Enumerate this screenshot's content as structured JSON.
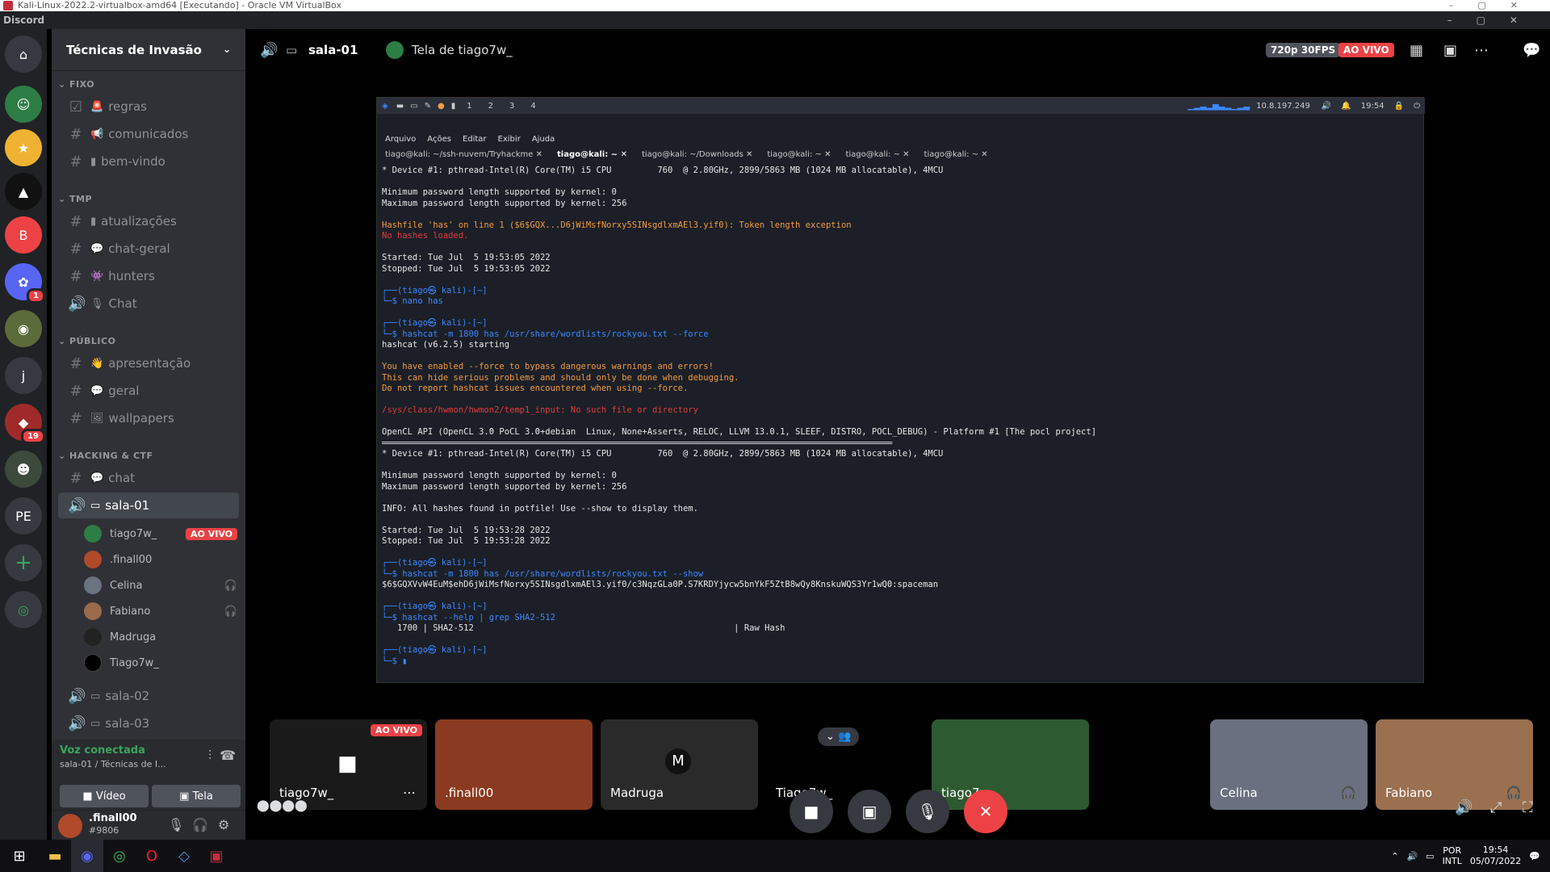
{
  "window": {
    "vbox_title": "Kali-Linux-2022.2-virtualbox-amd64 [Executando] - Oracle VM VirtualBox",
    "app_title": "Discord"
  },
  "server": {
    "name": "Técnicas de Invasão"
  },
  "categories": {
    "fixo": "FIXO",
    "tmp": "TMP",
    "publico": "PÚBLICO",
    "hacking": "HACKING & CTF"
  },
  "channels": {
    "regras": "regras",
    "comunicados": "comunicados",
    "bem_vindo": "bem-vindo",
    "atualizacoes": "atualizações",
    "chat_geral": "chat-geral",
    "hunters": "hunters",
    "chat_voice": "Chat",
    "apresentacao": "apresentação",
    "geral": "geral",
    "wallpapers": "wallpapers",
    "chat": "chat",
    "sala01": "sala-01",
    "sala02": "sala-02",
    "sala03": "sala-03"
  },
  "voice_users": [
    {
      "name": "tiago7w_",
      "live": "AO VIVO"
    },
    {
      "name": ".finall00"
    },
    {
      "name": "Celina"
    },
    {
      "name": "Fabiano"
    },
    {
      "name": "Madruga"
    },
    {
      "name": "Tiago7w_"
    }
  ],
  "voice_status": {
    "connected": "Voz conectada",
    "location": "sala-01 / Técnicas de I...",
    "video": "Vídeo",
    "screen": "Tela"
  },
  "user": {
    "name": ".finall00",
    "tag": "#9806"
  },
  "topbar": {
    "channel": "sala-01",
    "stream": "Tela de tiago7w_",
    "quality": "720p 30FPS",
    "live": "AO VIVO"
  },
  "vm": {
    "workspaces": [
      "1",
      "2",
      "3",
      "4"
    ],
    "clock": "19:54",
    "ip": "10.8.197.249",
    "menu": [
      "Arquivo",
      "Ações",
      "Editar",
      "Exibir",
      "Ajuda"
    ],
    "tabs": [
      "tiago@kali: ~/ssh-nuvem/Tryhackme",
      "tiago@kali: ~",
      "tiago@kali: ~/Downloads",
      "tiago@kali: ~",
      "tiago@kali: ~",
      "tiago@kali: ~"
    ]
  },
  "terminal": [
    {
      "t": "* Device #1: pthread-Intel(R) Core(TM) i5 CPU         760  @ 2.80GHz, 2899/5863 MB (1024 MB allocatable), 4MCU",
      "c": ""
    },
    {
      "t": "",
      "c": ""
    },
    {
      "t": "Minimum password length supported by kernel: 0",
      "c": ""
    },
    {
      "t": "Maximum password length supported by kernel: 256",
      "c": ""
    },
    {
      "t": "",
      "c": ""
    },
    {
      "t": "Hashfile 'has' on line 1 ($6$GQX...D6jWiMsfNorxy5SINsgdlxmAEl3.yif0): Token length exception",
      "c": "or"
    },
    {
      "t": "No hashes loaded.",
      "c": "rd"
    },
    {
      "t": "",
      "c": ""
    },
    {
      "t": "Started: Tue Jul  5 19:53:05 2022",
      "c": ""
    },
    {
      "t": "Stopped: Tue Jul  5 19:53:05 2022",
      "c": ""
    },
    {
      "t": "",
      "c": ""
    },
    {
      "t": "┌──(tiago㉿ kali)-[~]",
      "c": "bl"
    },
    {
      "t": "└─$ nano has",
      "c": "bl"
    },
    {
      "t": "",
      "c": ""
    },
    {
      "t": "┌──(tiago㉿ kali)-[~]",
      "c": "bl"
    },
    {
      "t": "└─$ hashcat -m 1800 has /usr/share/wordlists/rockyou.txt --force",
      "c": "bl"
    },
    {
      "t": "hashcat (v6.2.5) starting",
      "c": ""
    },
    {
      "t": "",
      "c": ""
    },
    {
      "t": "You have enabled --force to bypass dangerous warnings and errors!",
      "c": "or"
    },
    {
      "t": "This can hide serious problems and should only be done when debugging.",
      "c": "or"
    },
    {
      "t": "Do not report hashcat issues encountered when using --force.",
      "c": "or"
    },
    {
      "t": "",
      "c": ""
    },
    {
      "t": "/sys/class/hwmon/hwmon2/temp1_input: No such file or directory",
      "c": "rd"
    },
    {
      "t": "",
      "c": ""
    },
    {
      "t": "OpenCL API (OpenCL 3.0 PoCL 3.0+debian  Linux, None+Asserts, RELOC, LLVM 13.0.1, SLEEF, DISTRO, POCL_DEBUG) - Platform #1 [The pocl project]",
      "c": ""
    },
    {
      "t": "════════════════════════════════════════════════════════════════════════════════════════════════════",
      "c": ""
    },
    {
      "t": "* Device #1: pthread-Intel(R) Core(TM) i5 CPU         760  @ 2.80GHz, 2899/5863 MB (1024 MB allocatable), 4MCU",
      "c": ""
    },
    {
      "t": "",
      "c": ""
    },
    {
      "t": "Minimum password length supported by kernel: 0",
      "c": ""
    },
    {
      "t": "Maximum password length supported by kernel: 256",
      "c": ""
    },
    {
      "t": "",
      "c": ""
    },
    {
      "t": "INFO: All hashes found in potfile! Use --show to display them.",
      "c": ""
    },
    {
      "t": "",
      "c": ""
    },
    {
      "t": "Started: Tue Jul  5 19:53:28 2022",
      "c": ""
    },
    {
      "t": "Stopped: Tue Jul  5 19:53:28 2022",
      "c": ""
    },
    {
      "t": "",
      "c": ""
    },
    {
      "t": "┌──(tiago㉿ kali)-[~]",
      "c": "bl"
    },
    {
      "t": "└─$ hashcat -m 1800 has /usr/share/wordlists/rockyou.txt --show",
      "c": "bl"
    },
    {
      "t": "$6$GQXVvW4EuM$ehD6jWiMsfNorxy5SINsgdlxmAEl3.yif0/c3NqzGLa0P.S7KRDYjycw5bnYkF5ZtB8wQy8KnskuWQS3Yr1wQ0:spaceman",
      "c": ""
    },
    {
      "t": "",
      "c": ""
    },
    {
      "t": "┌──(tiago㉿ kali)-[~]",
      "c": "bl"
    },
    {
      "t": "└─$ hashcat --help | grep SHA2-512",
      "c": "bl"
    },
    {
      "t": "   1700 | SHA2-512                                                   | Raw Hash",
      "c": ""
    },
    {
      "t": "",
      "c": ""
    },
    {
      "t": "┌──(tiago㉿ kali)-[~]",
      "c": "bl"
    },
    {
      "t": "└─$ ▮",
      "c": "bl"
    }
  ],
  "tiles": [
    {
      "name": "tiago7w_",
      "live": "AO VIVO"
    },
    {
      "name": ".finall00"
    },
    {
      "name": "Madruga"
    },
    {
      "name": "Tiago7w_"
    },
    {
      "name": "tiago7w_"
    },
    {
      "name": "Celina"
    },
    {
      "name": "Fabiano"
    }
  ],
  "taskbar": {
    "lang1": "POR",
    "lang2": "INTL",
    "time": "19:54",
    "date": "05/07/2022"
  }
}
